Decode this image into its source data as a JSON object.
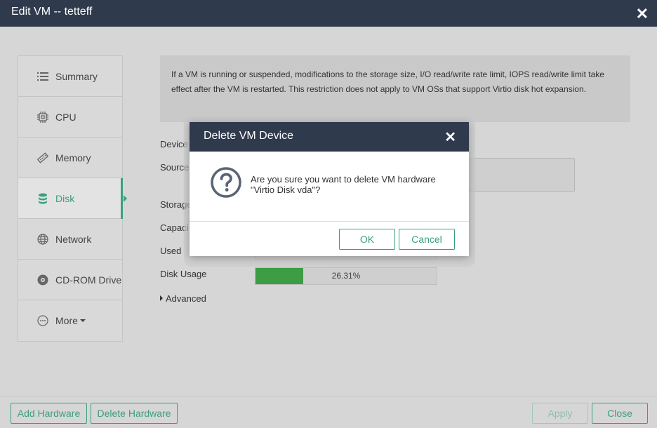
{
  "window": {
    "title": "Edit VM -- tetteff"
  },
  "sidebar": {
    "items": [
      {
        "label": "Summary",
        "icon": "list-icon"
      },
      {
        "label": "CPU",
        "icon": "chip-icon"
      },
      {
        "label": "Memory",
        "icon": "memory-icon"
      },
      {
        "label": "Disk",
        "icon": "database-icon",
        "active": true
      },
      {
        "label": "Network",
        "icon": "globe-icon"
      },
      {
        "label": "CD-ROM Drive",
        "icon": "disc-icon"
      },
      {
        "label": "More",
        "icon": "ellipsis-icon"
      }
    ]
  },
  "notice": {
    "text": "If a VM is running or suspended, modifications to the storage size, I/O read/write rate limit, IOPS read/write limit take effect after the VM is restarted. This restriction does not apply to VM OSs that support Virtio disk hot expansion."
  },
  "form": {
    "device_label": "Device",
    "source_label": "Source",
    "storage_label": "Storage",
    "capacity_label": "Capaci",
    "used_label": "Used",
    "disk_usage_label": "Disk Usage",
    "disk_usage_text": "26.31%",
    "disk_usage_fraction": 0.2631,
    "advanced_label": "Advanced"
  },
  "footer": {
    "add_hardware": "Add Hardware",
    "delete_hardware": "Delete Hardware",
    "apply": "Apply",
    "close": "Close"
  },
  "dialog": {
    "title": "Delete VM Device",
    "message": "Are you sure you want to delete VM hardware \"Virtio Disk vda\"?",
    "ok": "OK",
    "cancel": "Cancel"
  },
  "colors": {
    "accent": "#3ba07a",
    "header": "#2f3a4d",
    "progress": "#3c9d44"
  }
}
